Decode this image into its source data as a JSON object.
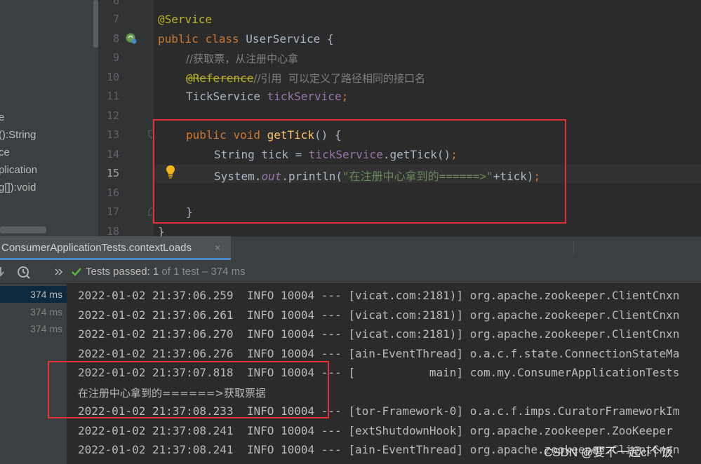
{
  "structure": {
    "items": [
      "e",
      "():String",
      "ce",
      "plication",
      "g[]):void"
    ]
  },
  "editor": {
    "line_numbers": [
      "6",
      "7",
      "8",
      "9",
      "10",
      "11",
      "12",
      "13",
      "14",
      "15",
      "16",
      "17",
      "18"
    ],
    "lines": {
      "l7_annotation": "@Service",
      "l8_kw_public": "public",
      "l8_kw_class": "class",
      "l8_rest": "UserService {",
      "l9_comment": "//获取票，从注册中心拿",
      "l10_annotation": "@Reference",
      "l10_comment": "//引用  可以定义了路径相同的接口名",
      "l11_type": "TickService",
      "l11_field": "tickService",
      "l11_end": ";",
      "l13_kw_public": "public",
      "l13_kw_void": "void",
      "l13_method": "getTick",
      "l13_rest": "() {",
      "l14_type": "String tick = ",
      "l14_field": "tickService",
      "l14_call": ".getTick()",
      "l14_end": ";",
      "l15_system": "System.",
      "l15_out": "out",
      "l15_println": ".println(",
      "l15_string": "\"在注册中心拿到的======>\"",
      "l15_rest": "+tick)",
      "l15_end": ";",
      "l17_brace": "}",
      "l18_brace": "}"
    }
  },
  "tab": {
    "label": "ConsumerApplicationTests.contextLoads",
    "close": "×"
  },
  "run_toolbar": {
    "status_label": "Tests passed:",
    "status_count": "1",
    "status_rest": "of 1 test – 374 ms"
  },
  "tree": {
    "times": [
      "374 ms",
      "374 ms",
      "374 ms"
    ]
  },
  "console": {
    "lines": [
      "2022-01-02 21:37:06.259  INFO 10004 --- [vicat.com:2181)] org.apache.zookeeper.ClientCnxn",
      "2022-01-02 21:37:06.261  INFO 10004 --- [vicat.com:2181)] org.apache.zookeeper.ClientCnxn",
      "2022-01-02 21:37:06.270  INFO 10004 --- [vicat.com:2181)] org.apache.zookeeper.ClientCnxn",
      "2022-01-02 21:37:06.276  INFO 10004 --- [ain-EventThread] o.a.c.f.state.ConnectionStateMa",
      "2022-01-02 21:37:07.818  INFO 10004 --- [           main] com.my.ConsumerApplicationTests",
      "在注册中心拿到的======>获取票据",
      "2022-01-02 21:37:08.233  INFO 10004 --- [tor-Framework-0] o.a.c.f.imps.CuratorFrameworkIm",
      "2022-01-02 21:37:08.241  INFO 10004 --- [extShutdownHook] org.apache.zookeeper.ZooKeeper",
      "2022-01-02 21:37:08.241  INFO 10004 --- [ain-EventThread] org.apache.zookeeper.ClientCnxn"
    ]
  },
  "watermark": "CSDN @要不一起ci个饭"
}
